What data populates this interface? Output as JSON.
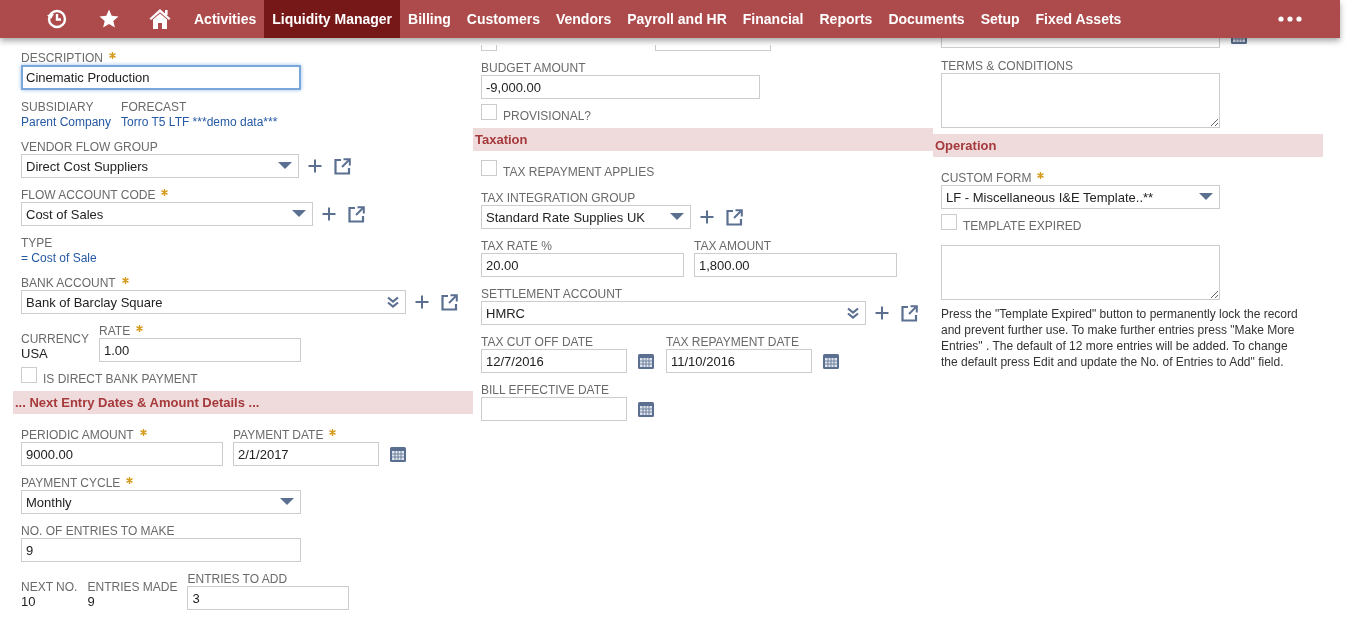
{
  "nav": {
    "tabs": [
      {
        "label": "Activities",
        "selected": false
      },
      {
        "label": "Liquidity Manager",
        "selected": true
      },
      {
        "label": "Billing",
        "selected": false
      },
      {
        "label": "Customers",
        "selected": false
      },
      {
        "label": "Vendors",
        "selected": false
      },
      {
        "label": "Payroll and HR",
        "selected": false
      },
      {
        "label": "Financial",
        "selected": false
      },
      {
        "label": "Reports",
        "selected": false
      },
      {
        "label": "Documents",
        "selected": false
      },
      {
        "label": "Setup",
        "selected": false
      },
      {
        "label": "Fixed Assets",
        "selected": false
      }
    ]
  },
  "columns": [
    {
      "items": [
        {
          "kind": "text_field",
          "label": "DESCRIPTION",
          "required": true,
          "value": "Cinematic Production",
          "focused": true
        },
        {
          "kind": "row",
          "fields": [
            {
              "kind": "display",
              "label": "SUBSIDIARY",
              "value": "Parent Company",
              "link": true
            },
            {
              "kind": "display",
              "label": "FORECAST",
              "value": "Torro T5 LTF ***demo data***",
              "link": true
            }
          ]
        },
        {
          "kind": "dropdown",
          "label": "VENDOR FLOW GROUP",
          "required": false,
          "value": "Direct Cost Suppliers",
          "quick_actions": true
        },
        {
          "kind": "dropdown",
          "label": "FLOW ACCOUNT CODE",
          "required": true,
          "value": "Cost of Sales",
          "quick_actions": true
        },
        {
          "kind": "display",
          "label": "TYPE",
          "value": "= Cost of Sale",
          "link": true
        },
        {
          "kind": "multi_select",
          "label": "BANK ACCOUNT",
          "required": true,
          "value": "Bank of Barclay Square",
          "quick_actions": true
        },
        {
          "kind": "row",
          "fields": [
            {
              "kind": "display",
              "label": "CURRENCY",
              "value": "USA",
              "link": false
            },
            {
              "kind": "text_field",
              "label": "RATE",
              "required": true,
              "value": "1.00"
            }
          ]
        },
        {
          "kind": "checkbox",
          "label": "IS DIRECT BANK PAYMENT",
          "checked": false
        },
        {
          "kind": "section",
          "title": "... Next Entry Dates & Amount Details ..."
        },
        {
          "kind": "row",
          "fields": [
            {
              "kind": "text_field",
              "label": "PERIODIC AMOUNT",
              "required": true,
              "value": "9000.00"
            },
            {
              "kind": "date_field",
              "label": "PAYMENT DATE",
              "required": true,
              "value": "2/1/2017"
            }
          ]
        },
        {
          "kind": "dropdown",
          "label": "PAYMENT CYCLE",
          "required": true,
          "value": "Monthly"
        },
        {
          "kind": "text_field",
          "label": "NO. OF ENTRIES TO MAKE",
          "required": false,
          "value": "9"
        },
        {
          "kind": "row",
          "fields": [
            {
              "kind": "display",
              "label": "NEXT NO.",
              "value": "10",
              "link": false
            },
            {
              "kind": "display",
              "label": "ENTRIES MADE",
              "value": "9",
              "link": false
            },
            {
              "kind": "text_field",
              "label": "ENTRIES TO ADD",
              "required": false,
              "value": "3"
            }
          ]
        }
      ]
    },
    {
      "items": [
        {
          "kind": "row",
          "fields": [
            {
              "kind": "checkbox",
              "checked": false
            },
            {
              "kind": "text_field"
            }
          ]
        },
        {
          "kind": "text_field",
          "label": "BUDGET AMOUNT",
          "required": false,
          "value": "-9,000.00"
        },
        {
          "kind": "checkbox",
          "label": "PROVISIONAL?",
          "checked": false
        },
        {
          "kind": "section",
          "title": "Taxation"
        },
        {
          "kind": "checkbox",
          "label": "TAX REPAYMENT APPLIES",
          "checked": false
        },
        {
          "kind": "dropdown",
          "label": "TAX INTEGRATION GROUP",
          "required": false,
          "value": "Standard Rate Supplies UK",
          "quick_actions": true
        },
        {
          "kind": "row",
          "fields": [
            {
              "kind": "text_field",
              "label": "TAX RATE %",
              "required": false,
              "value": "20.00"
            },
            {
              "kind": "text_field",
              "label": "TAX AMOUNT",
              "required": false,
              "value": "1,800.00"
            }
          ]
        },
        {
          "kind": "multi_select",
          "label": "SETTLEMENT ACCOUNT",
          "required": false,
          "value": "HMRC",
          "quick_actions": true
        },
        {
          "kind": "row",
          "fields": [
            {
              "kind": "date_field",
              "label": "TAX CUT OFF DATE",
              "required": false,
              "value": "12/7/2016"
            },
            {
              "kind": "date_field",
              "label": "TAX REPAYMENT DATE",
              "required": false,
              "value": "11/10/2016"
            }
          ]
        },
        {
          "kind": "date_field",
          "label": "BILL EFFECTIVE DATE",
          "required": false
        }
      ]
    },
    {
      "items": [
        {
          "kind": "date_field"
        },
        {
          "kind": "text_area",
          "label": "TERMS & CONDITIONS",
          "required": false
        },
        {
          "kind": "section",
          "title": "Operation"
        },
        {
          "kind": "dropdown",
          "label": "CUSTOM FORM",
          "required": true,
          "value": "LF - Miscellaneous I&E Template..**"
        },
        {
          "kind": "checkbox",
          "label": "TEMPLATE EXPIRED",
          "checked": false
        },
        {
          "kind": "text_area"
        },
        {
          "kind": "note",
          "text": "Press the \"Template Expired\" button to permanently lock the record and prevent further use. To make further entries press \"Make More Entries\" . The default of 12 more entries will be added. To change the default press Edit and update the No. of Entries to Add\" field."
        }
      ]
    }
  ]
}
